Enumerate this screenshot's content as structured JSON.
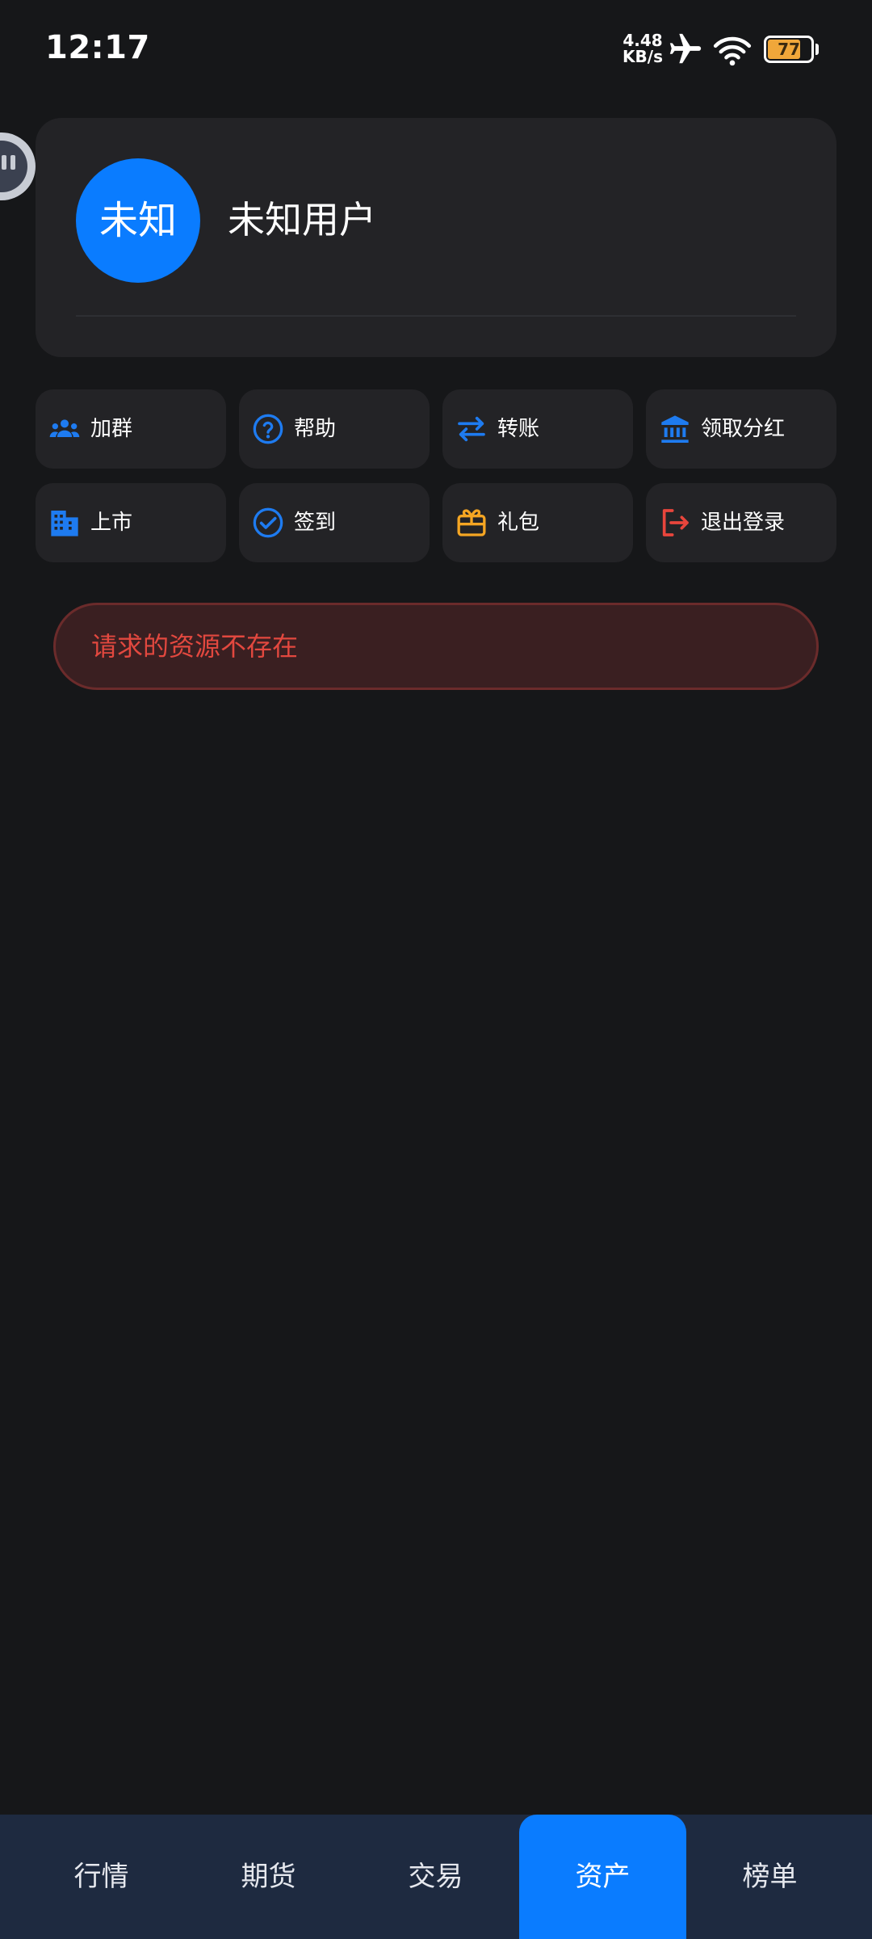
{
  "status_bar": {
    "time": "12:17",
    "net_speed_value": "4.48",
    "net_speed_unit": "KB/s",
    "battery_level": "77",
    "icons": [
      "airplane-icon",
      "wifi-icon",
      "battery-icon"
    ]
  },
  "profile": {
    "avatar_text": "未知",
    "user_name": "未知用户",
    "avatar_color": "#0a7cff"
  },
  "actions": [
    {
      "label": "加群",
      "icon": "group-icon",
      "color": "#1e7bf0"
    },
    {
      "label": "帮助",
      "icon": "help-icon",
      "color": "#1e7bf0"
    },
    {
      "label": "转账",
      "icon": "transfer-icon",
      "color": "#1e7bf0"
    },
    {
      "label": "领取分红",
      "icon": "bank-icon",
      "color": "#1e7bf0"
    },
    {
      "label": "上市",
      "icon": "building-icon",
      "color": "#1e7bf0"
    },
    {
      "label": "签到",
      "icon": "check-circle-icon",
      "color": "#1e7bf0"
    },
    {
      "label": "礼包",
      "icon": "gift-icon",
      "color": "#f5a623"
    },
    {
      "label": "退出登录",
      "icon": "logout-icon",
      "color": "#e8453c"
    }
  ],
  "error": {
    "message": "请求的资源不存在"
  },
  "bottom_nav": {
    "items": [
      {
        "label": "行情",
        "active": false
      },
      {
        "label": "期货",
        "active": false
      },
      {
        "label": "交易",
        "active": false
      },
      {
        "label": "资产",
        "active": true
      },
      {
        "label": "榜单",
        "active": false
      }
    ]
  },
  "colors": {
    "background": "#161719",
    "card": "#232326",
    "accent": "#0a7cff",
    "error_text": "#e2483f",
    "nav_background": "#1e2a40"
  }
}
